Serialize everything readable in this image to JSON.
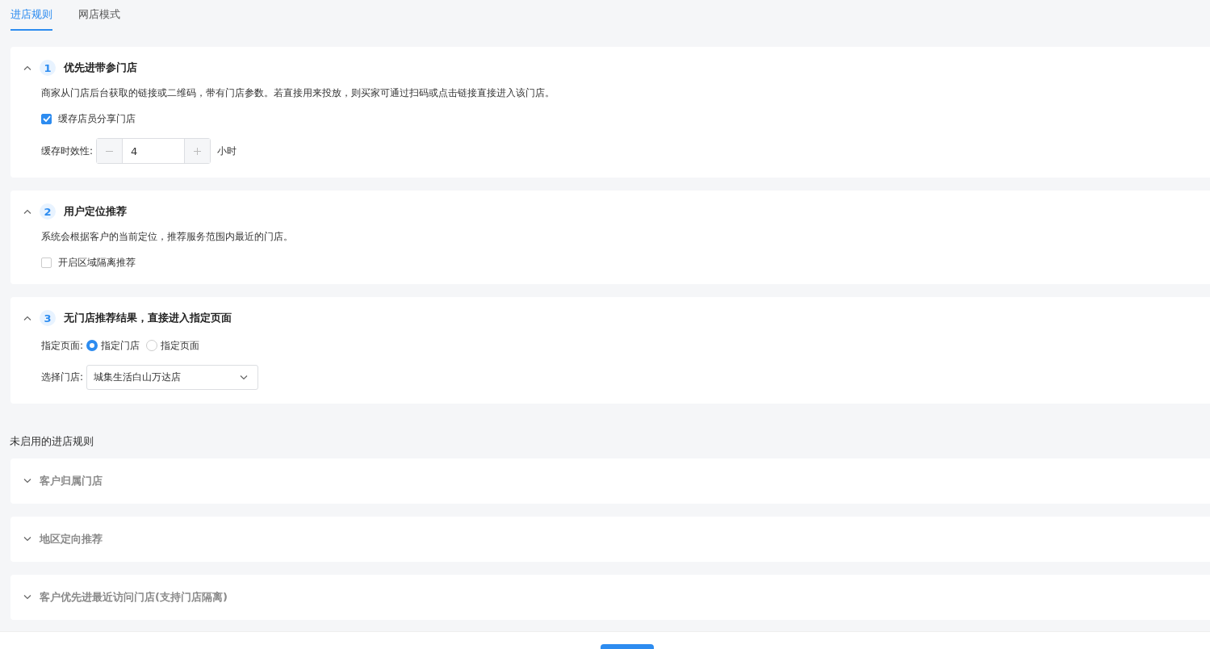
{
  "tabs": [
    {
      "label": "进店规则",
      "selected": true
    },
    {
      "label": "网店模式",
      "selected": false
    }
  ],
  "rules": [
    {
      "number": "1",
      "title": "优先进带参门店",
      "expanded": true,
      "description": "商家从门店后台获取的链接或二维码，带有门店参数。若直接用来投放，则买家可通过扫码或点击链接直接进入该门店。",
      "fields": [
        {
          "kind": "checkbox",
          "label": "缓存店员分享门店",
          "checked": true
        },
        {
          "kind": "stepper",
          "label": "缓存时效性:",
          "value": "4",
          "unit": "小时"
        }
      ]
    },
    {
      "number": "2",
      "title": "用户定位推荐",
      "expanded": true,
      "description": "系统会根据客户的当前定位，推荐服务范围内最近的门店。",
      "fields": [
        {
          "kind": "checkbox",
          "label": "开启区域隔离推荐",
          "checked": false
        }
      ]
    },
    {
      "number": "3",
      "title": "无门店推荐结果，直接进入指定页面",
      "expanded": true,
      "fields": [
        {
          "kind": "radio",
          "label": "指定页面:",
          "options": [
            {
              "label": "指定门店",
              "selected": true
            },
            {
              "label": "指定页面",
              "selected": false
            }
          ]
        },
        {
          "kind": "select",
          "label": "选择门店:",
          "value": "城集生活白山万达店"
        }
      ]
    }
  ],
  "inactive": {
    "title": "未启用的进店规则",
    "rules": [
      {
        "title": "客户归属门店",
        "expanded": false
      },
      {
        "title": "地区定向推荐",
        "expanded": false
      },
      {
        "title": "客户优先进最近访问门店(支持门店隔离)",
        "expanded": false
      }
    ]
  }
}
